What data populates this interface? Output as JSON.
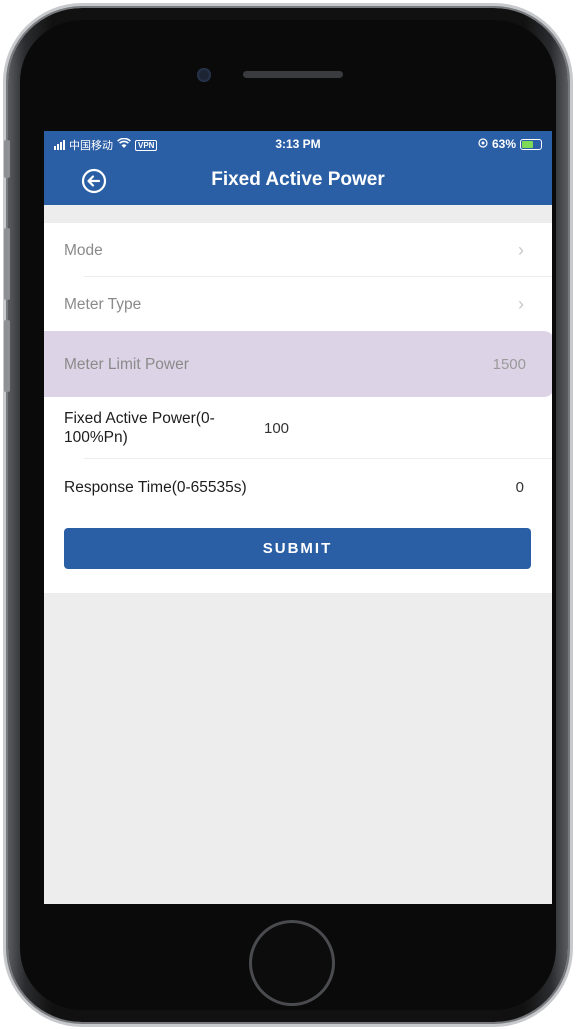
{
  "status_bar": {
    "carrier": "中国移动",
    "vpn": "VPN",
    "time": "3:13 PM",
    "battery": "63%",
    "battery_level": 0.63
  },
  "nav": {
    "title": "Fixed Active Power",
    "back_icon": "back-arrow-circle-icon"
  },
  "rows": [
    {
      "label": "Mode",
      "value": "",
      "chevron": true
    },
    {
      "label": "Meter Type",
      "value": "",
      "chevron": true
    },
    {
      "label": "Meter Limit Power",
      "value": "1500"
    },
    {
      "label": "Fixed Active Power(0-100%Pn)",
      "value": "100"
    },
    {
      "label": "Response Time(0-65535s)",
      "value": "0"
    }
  ],
  "submit_label": "SUBMIT",
  "colors": {
    "primary": "#2b5fa5",
    "highlight": "#ddd3e6",
    "background": "#ededee"
  }
}
